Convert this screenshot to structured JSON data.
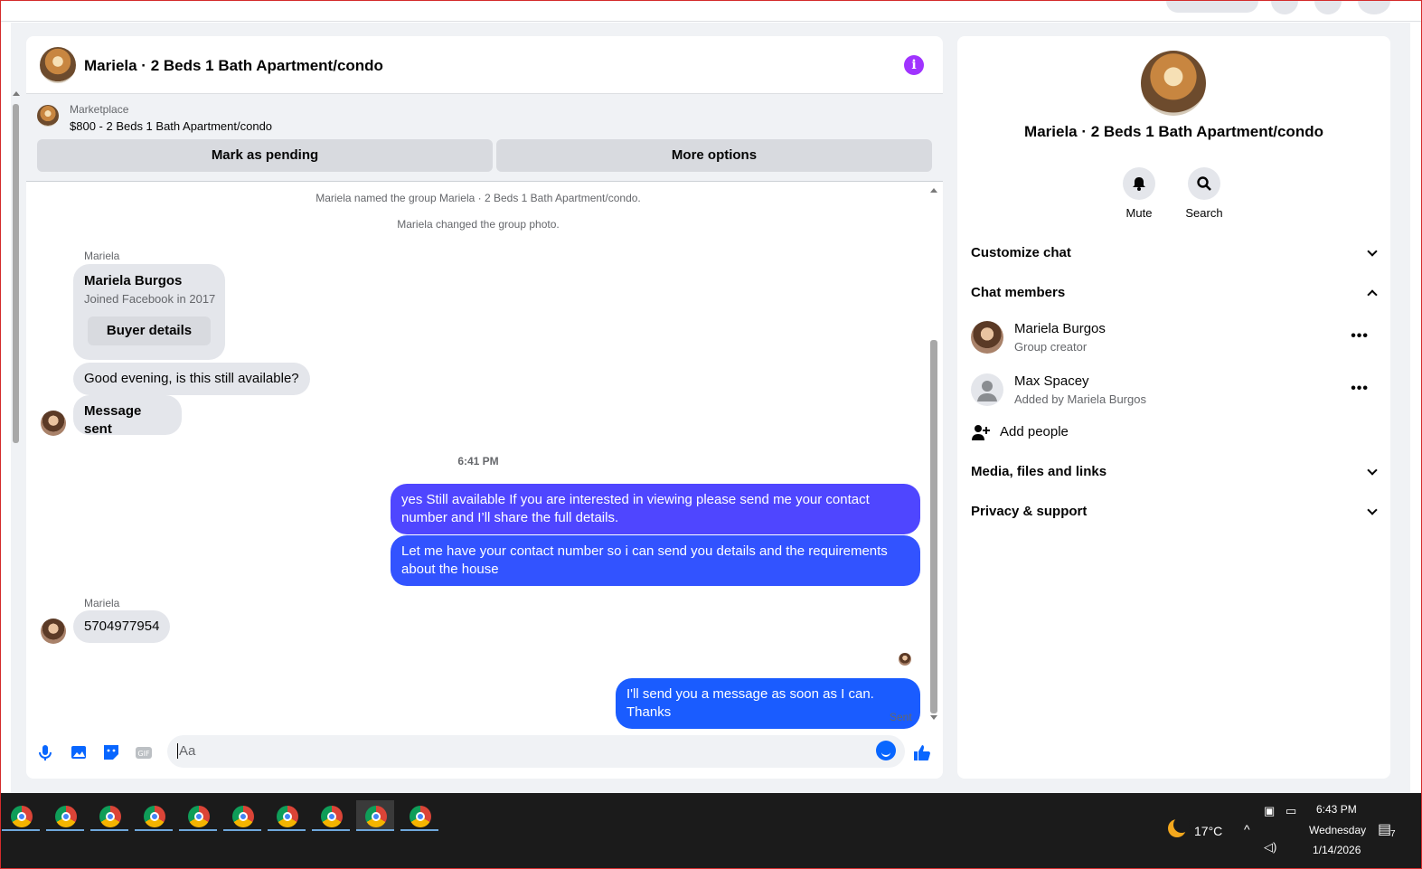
{
  "chat": {
    "title": "Mariela · 2 Beds 1 Bath Apartment/condo",
    "marketplace_label": "Marketplace",
    "listing": "$800 - 2 Beds 1 Bath Apartment/condo",
    "mark_pending": "Mark as pending",
    "more_options": "More options",
    "system_messages": [
      "Mariela named the group Mariela · 2 Beds 1 Bath Apartment/condo.",
      "Mariela changed the group photo."
    ],
    "sender_name": "Mariela",
    "buyer_card": {
      "name": "Mariela Burgos",
      "joined": "Joined Facebook in 2017",
      "button": "Buyer details"
    },
    "messages": {
      "m1": "Good evening, is this still available?",
      "m2": "Message sent",
      "timestamp": "6:41 PM",
      "m3": "yes Still available If you are interested in viewing please send me your contact number and I’ll share the full details.",
      "m4": "Let me have your contact number so i can send you details and the requirements about the house",
      "m5_sender": "Mariela",
      "m5": "5704977954",
      "m6": "I'll send you a message as soon as I can. Thanks",
      "status": "Sent"
    },
    "composer_placeholder": "Aa",
    "colors": {
      "outgoing_top": "#4f46ff",
      "outgoing_bottom": "#1a5cff",
      "accent": "#0866ff",
      "info": "#a033ff"
    }
  },
  "sidebar": {
    "title": "Mariela · 2 Beds 1 Bath Apartment/condo",
    "actions": {
      "mute": "Mute",
      "search": "Search"
    },
    "customize": "Customize chat",
    "members_header": "Chat members",
    "members": [
      {
        "name": "Mariela Burgos",
        "role": "Group creator"
      },
      {
        "name": "Max Spacey",
        "role": "Added by Mariela Burgos"
      }
    ],
    "add_people": "Add people",
    "media": "Media, files and links",
    "privacy": "Privacy & support"
  },
  "taskbar": {
    "app_count": 10,
    "temperature": "17°C",
    "time": "6:43 PM",
    "day": "Wednesday",
    "date": "1/14/2026",
    "notifications": "7"
  }
}
